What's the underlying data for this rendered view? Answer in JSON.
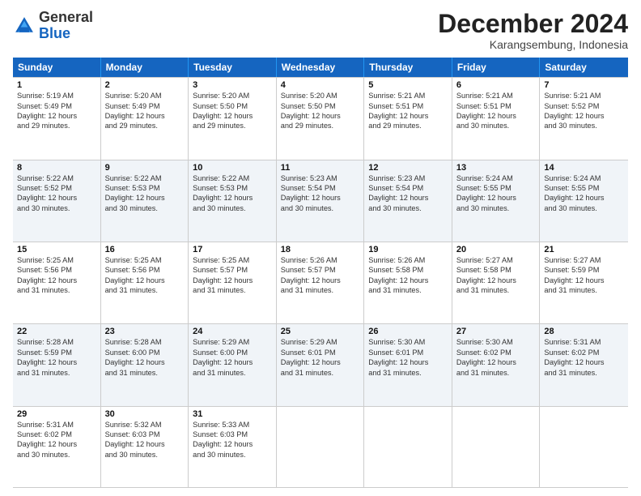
{
  "header": {
    "logo": {
      "text_general": "General",
      "text_blue": "Blue"
    },
    "title": "December 2024",
    "location": "Karangsembung, Indonesia"
  },
  "weekdays": [
    "Sunday",
    "Monday",
    "Tuesday",
    "Wednesday",
    "Thursday",
    "Friday",
    "Saturday"
  ],
  "rows": [
    [
      {
        "day": "1",
        "info": "Sunrise: 5:19 AM\nSunset: 5:49 PM\nDaylight: 12 hours\nand 29 minutes."
      },
      {
        "day": "2",
        "info": "Sunrise: 5:20 AM\nSunset: 5:49 PM\nDaylight: 12 hours\nand 29 minutes."
      },
      {
        "day": "3",
        "info": "Sunrise: 5:20 AM\nSunset: 5:50 PM\nDaylight: 12 hours\nand 29 minutes."
      },
      {
        "day": "4",
        "info": "Sunrise: 5:20 AM\nSunset: 5:50 PM\nDaylight: 12 hours\nand 29 minutes."
      },
      {
        "day": "5",
        "info": "Sunrise: 5:21 AM\nSunset: 5:51 PM\nDaylight: 12 hours\nand 29 minutes."
      },
      {
        "day": "6",
        "info": "Sunrise: 5:21 AM\nSunset: 5:51 PM\nDaylight: 12 hours\nand 30 minutes."
      },
      {
        "day": "7",
        "info": "Sunrise: 5:21 AM\nSunset: 5:52 PM\nDaylight: 12 hours\nand 30 minutes."
      }
    ],
    [
      {
        "day": "8",
        "info": "Sunrise: 5:22 AM\nSunset: 5:52 PM\nDaylight: 12 hours\nand 30 minutes."
      },
      {
        "day": "9",
        "info": "Sunrise: 5:22 AM\nSunset: 5:53 PM\nDaylight: 12 hours\nand 30 minutes."
      },
      {
        "day": "10",
        "info": "Sunrise: 5:22 AM\nSunset: 5:53 PM\nDaylight: 12 hours\nand 30 minutes."
      },
      {
        "day": "11",
        "info": "Sunrise: 5:23 AM\nSunset: 5:54 PM\nDaylight: 12 hours\nand 30 minutes."
      },
      {
        "day": "12",
        "info": "Sunrise: 5:23 AM\nSunset: 5:54 PM\nDaylight: 12 hours\nand 30 minutes."
      },
      {
        "day": "13",
        "info": "Sunrise: 5:24 AM\nSunset: 5:55 PM\nDaylight: 12 hours\nand 30 minutes."
      },
      {
        "day": "14",
        "info": "Sunrise: 5:24 AM\nSunset: 5:55 PM\nDaylight: 12 hours\nand 30 minutes."
      }
    ],
    [
      {
        "day": "15",
        "info": "Sunrise: 5:25 AM\nSunset: 5:56 PM\nDaylight: 12 hours\nand 31 minutes."
      },
      {
        "day": "16",
        "info": "Sunrise: 5:25 AM\nSunset: 5:56 PM\nDaylight: 12 hours\nand 31 minutes."
      },
      {
        "day": "17",
        "info": "Sunrise: 5:25 AM\nSunset: 5:57 PM\nDaylight: 12 hours\nand 31 minutes."
      },
      {
        "day": "18",
        "info": "Sunrise: 5:26 AM\nSunset: 5:57 PM\nDaylight: 12 hours\nand 31 minutes."
      },
      {
        "day": "19",
        "info": "Sunrise: 5:26 AM\nSunset: 5:58 PM\nDaylight: 12 hours\nand 31 minutes."
      },
      {
        "day": "20",
        "info": "Sunrise: 5:27 AM\nSunset: 5:58 PM\nDaylight: 12 hours\nand 31 minutes."
      },
      {
        "day": "21",
        "info": "Sunrise: 5:27 AM\nSunset: 5:59 PM\nDaylight: 12 hours\nand 31 minutes."
      }
    ],
    [
      {
        "day": "22",
        "info": "Sunrise: 5:28 AM\nSunset: 5:59 PM\nDaylight: 12 hours\nand 31 minutes."
      },
      {
        "day": "23",
        "info": "Sunrise: 5:28 AM\nSunset: 6:00 PM\nDaylight: 12 hours\nand 31 minutes."
      },
      {
        "day": "24",
        "info": "Sunrise: 5:29 AM\nSunset: 6:00 PM\nDaylight: 12 hours\nand 31 minutes."
      },
      {
        "day": "25",
        "info": "Sunrise: 5:29 AM\nSunset: 6:01 PM\nDaylight: 12 hours\nand 31 minutes."
      },
      {
        "day": "26",
        "info": "Sunrise: 5:30 AM\nSunset: 6:01 PM\nDaylight: 12 hours\nand 31 minutes."
      },
      {
        "day": "27",
        "info": "Sunrise: 5:30 AM\nSunset: 6:02 PM\nDaylight: 12 hours\nand 31 minutes."
      },
      {
        "day": "28",
        "info": "Sunrise: 5:31 AM\nSunset: 6:02 PM\nDaylight: 12 hours\nand 31 minutes."
      }
    ],
    [
      {
        "day": "29",
        "info": "Sunrise: 5:31 AM\nSunset: 6:02 PM\nDaylight: 12 hours\nand 30 minutes."
      },
      {
        "day": "30",
        "info": "Sunrise: 5:32 AM\nSunset: 6:03 PM\nDaylight: 12 hours\nand 30 minutes."
      },
      {
        "day": "31",
        "info": "Sunrise: 5:33 AM\nSunset: 6:03 PM\nDaylight: 12 hours\nand 30 minutes."
      },
      {
        "day": "",
        "info": ""
      },
      {
        "day": "",
        "info": ""
      },
      {
        "day": "",
        "info": ""
      },
      {
        "day": "",
        "info": ""
      }
    ]
  ]
}
